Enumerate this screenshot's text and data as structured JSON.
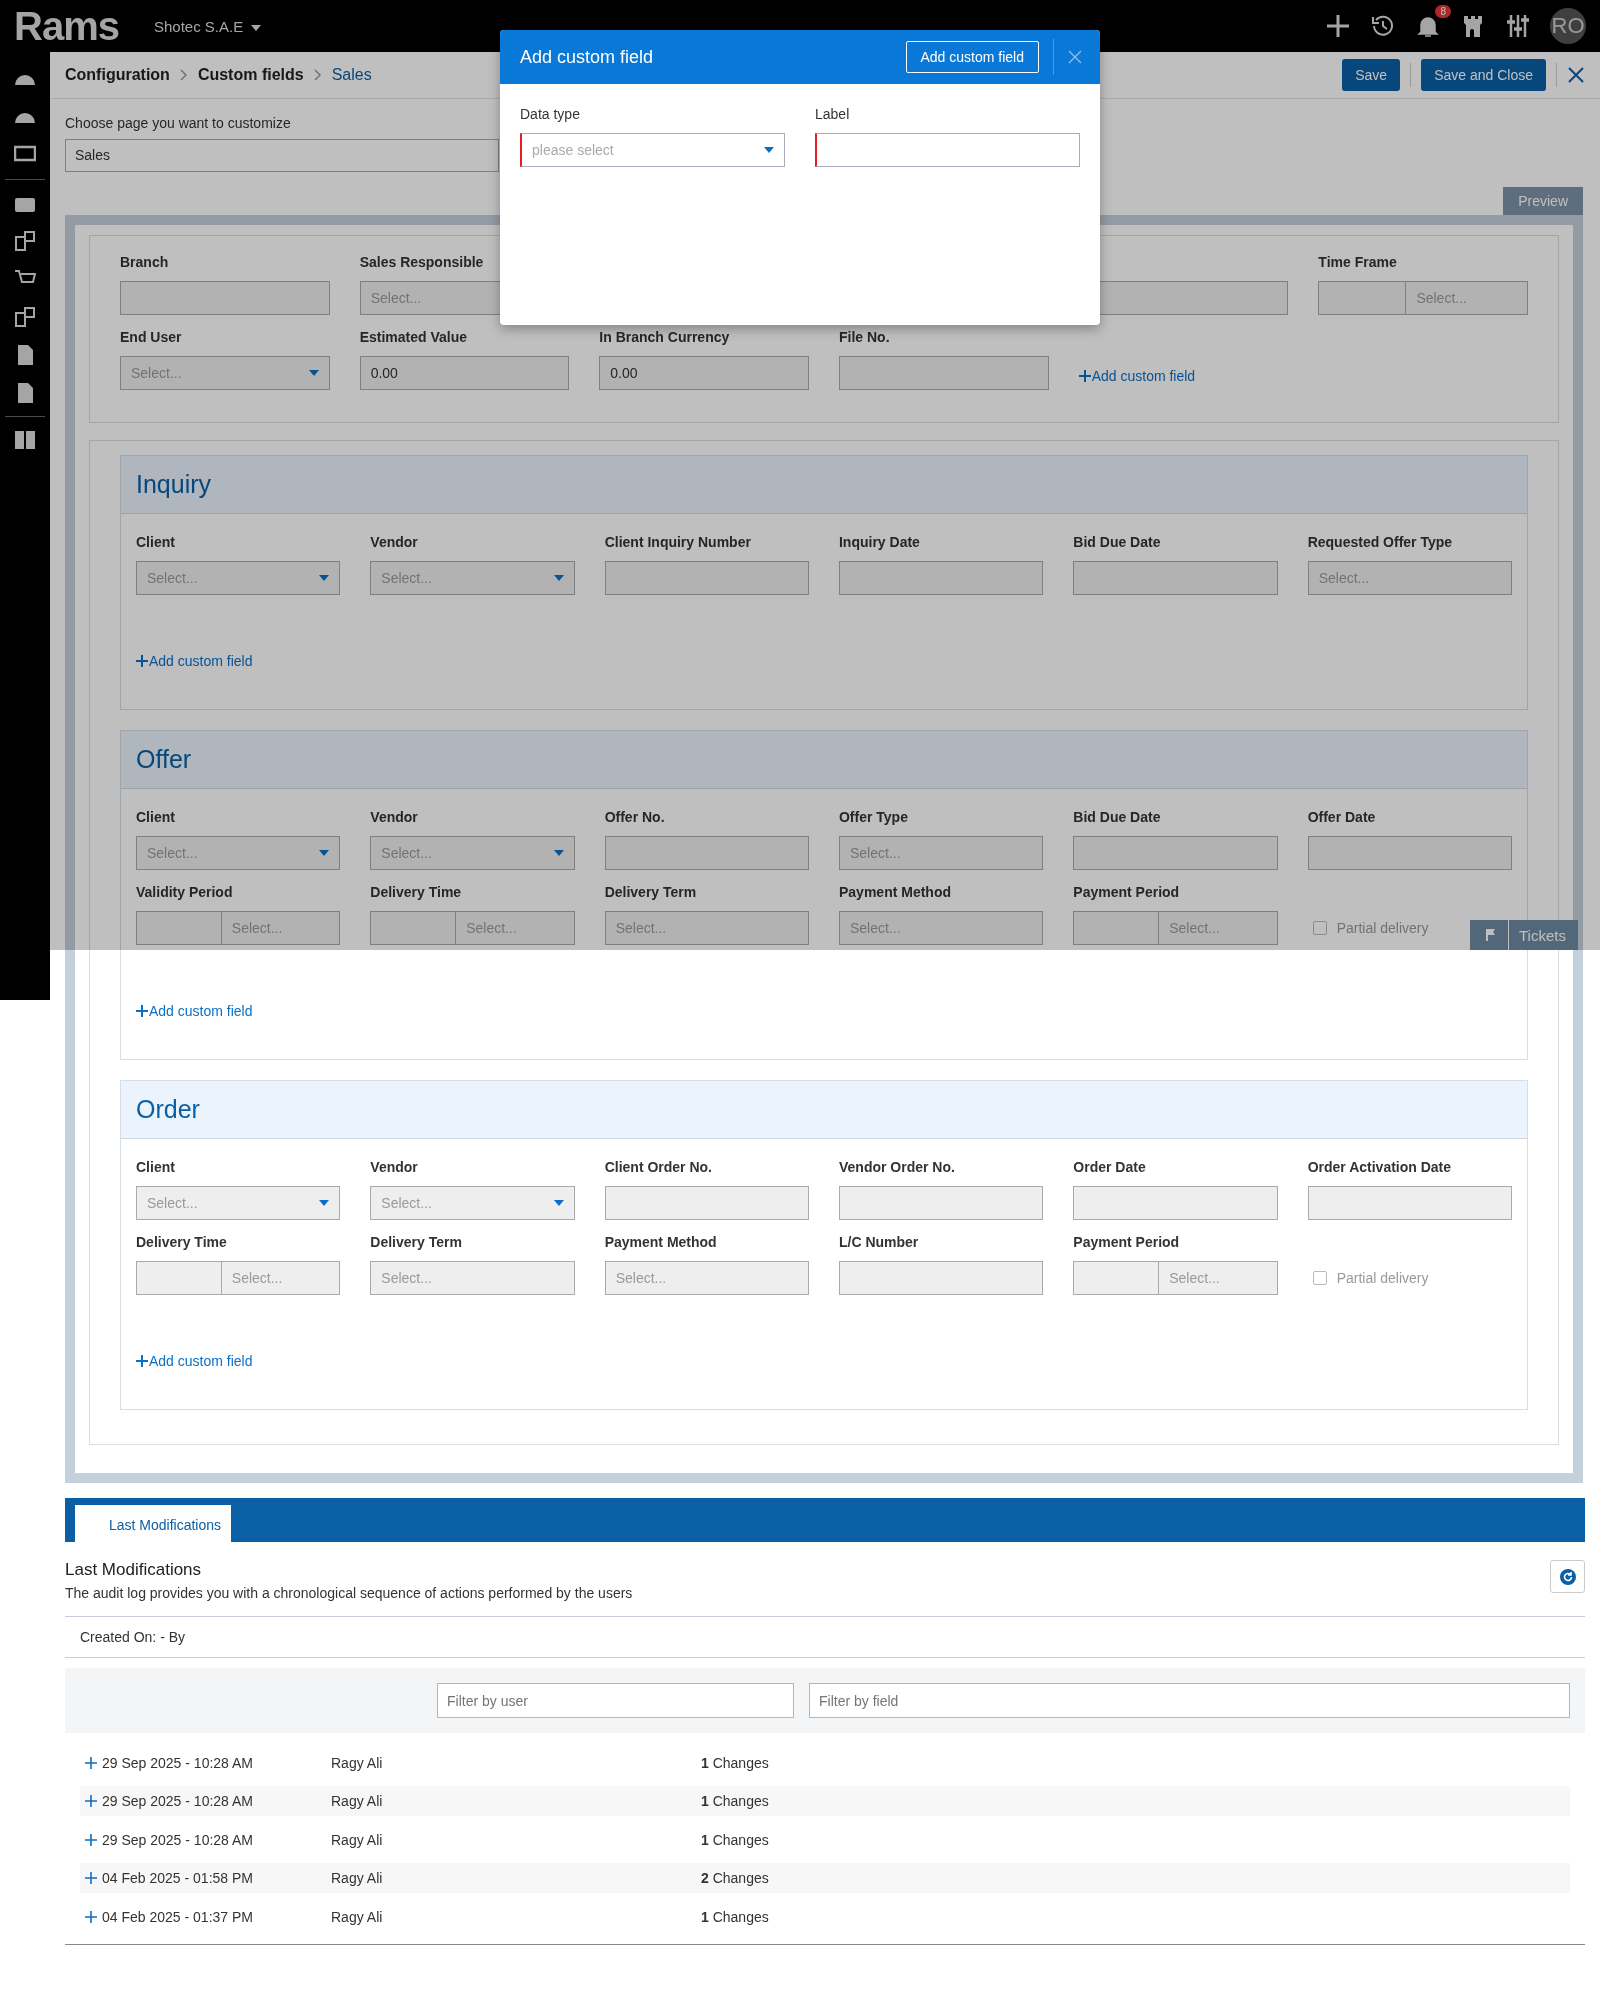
{
  "app": {
    "logo": "Rams",
    "company": "Shotec S.A.E",
    "notification_count": "8",
    "avatar": "RO"
  },
  "breadcrumb": [
    {
      "label": "Configuration",
      "current": false
    },
    {
      "label": "Custom fields",
      "current": false
    },
    {
      "label": "Sales",
      "current": true
    }
  ],
  "actions": [
    "Save",
    "Save and Close"
  ],
  "page_chooser": {
    "label": "Choose page you want to customize",
    "value": "Sales"
  },
  "preview_tab": "Preview",
  "general": {
    "fields": [
      {
        "label": "Branch",
        "kind": "input"
      },
      {
        "label": "Sales Responsible",
        "kind": "input",
        "placeholder": "Select..."
      },
      {
        "kind": "input"
      },
      {
        "label": "Time Frame",
        "kind": "split",
        "placeholder": "Select..."
      },
      {
        "label": "End User",
        "kind": "dropdown",
        "placeholder": "Select..."
      },
      {
        "label": "Estimated Value",
        "kind": "input",
        "value": "0.00"
      },
      {
        "label": "In Branch Currency",
        "kind": "input",
        "value": "0.00"
      },
      {
        "label": "File No.",
        "kind": "input"
      }
    ],
    "add_link": "Add custom field"
  },
  "sections": [
    {
      "title": "Inquiry",
      "fields": [
        {
          "label": "Client",
          "kind": "dropdown",
          "placeholder": "Select..."
        },
        {
          "label": "Vendor",
          "kind": "dropdown",
          "placeholder": "Select..."
        },
        {
          "label": "Client Inquiry Number",
          "kind": "input"
        },
        {
          "label": "Inquiry Date",
          "kind": "input"
        },
        {
          "label": "Bid Due Date",
          "kind": "input"
        },
        {
          "label": "Requested Offer Type",
          "kind": "input",
          "placeholder": "Select..."
        }
      ],
      "add_link": "Add custom field"
    },
    {
      "title": "Offer",
      "fields": [
        {
          "label": "Client",
          "kind": "dropdown",
          "placeholder": "Select..."
        },
        {
          "label": "Vendor",
          "kind": "dropdown",
          "placeholder": "Select..."
        },
        {
          "label": "Offer No.",
          "kind": "input"
        },
        {
          "label": "Offer Type",
          "kind": "input",
          "placeholder": "Select..."
        },
        {
          "label": "Bid Due Date",
          "kind": "input"
        },
        {
          "label": "Offer Date",
          "kind": "input"
        },
        {
          "label": "Validity Period",
          "kind": "split",
          "placeholder": "Select..."
        },
        {
          "label": "Delivery Time",
          "kind": "split",
          "placeholder": "Select..."
        },
        {
          "label": "Delivery Term",
          "kind": "input",
          "placeholder": "Select..."
        },
        {
          "label": "Payment Method",
          "kind": "input",
          "placeholder": "Select..."
        },
        {
          "label": "Payment Period",
          "kind": "split",
          "placeholder": "Select..."
        },
        {
          "label": "Partial delivery",
          "kind": "checkbox",
          "checked": false
        }
      ],
      "add_link": "Add custom field"
    },
    {
      "title": "Order",
      "fields": [
        {
          "label": "Client",
          "kind": "dropdown",
          "placeholder": "Select..."
        },
        {
          "label": "Vendor",
          "kind": "dropdown",
          "placeholder": "Select..."
        },
        {
          "label": "Client Order No.",
          "kind": "input"
        },
        {
          "label": "Vendor Order No.",
          "kind": "input"
        },
        {
          "label": "Order Date",
          "kind": "input"
        },
        {
          "label": "Order Activation Date",
          "kind": "input"
        },
        {
          "label": "Delivery Time",
          "kind": "split",
          "placeholder": "Select..."
        },
        {
          "label": "Delivery Term",
          "kind": "input",
          "placeholder": "Select..."
        },
        {
          "label": "Payment Method",
          "kind": "input",
          "placeholder": "Select..."
        },
        {
          "label": "L/C Number",
          "kind": "input"
        },
        {
          "label": "Payment Period",
          "kind": "split",
          "placeholder": "Select..."
        },
        {
          "label": "Partial delivery",
          "kind": "checkbox",
          "checked": false
        }
      ],
      "add_link": "Add custom field"
    }
  ],
  "tickets": "Tickets",
  "modal": {
    "title": "Add custom field",
    "button": "Add custom field",
    "fields": [
      {
        "label": "Data type",
        "kind": "dropdown",
        "placeholder": "please select"
      },
      {
        "label": "Label",
        "kind": "input"
      }
    ]
  },
  "audit": {
    "tab": "Last Modifications",
    "title": "Last Modifications",
    "description": "The audit log provides you with a chronological sequence of actions performed by the users",
    "created": "Created On: - By",
    "filters": [
      {
        "placeholder": "Filter by user"
      },
      {
        "placeholder": "Filter by field"
      }
    ],
    "rows": [
      {
        "date": "29 Sep 2025 - 10:28 AM",
        "user": "Ragy Ali",
        "count": "1",
        "changes": "Changes"
      },
      {
        "date": "29 Sep 2025 - 10:28 AM",
        "user": "Ragy Ali",
        "count": "1",
        "changes": "Changes"
      },
      {
        "date": "29 Sep 2025 - 10:28 AM",
        "user": "Ragy Ali",
        "count": "1",
        "changes": "Changes"
      },
      {
        "date": "04 Feb 2025 - 01:58 PM",
        "user": "Ragy Ali",
        "count": "2",
        "changes": "Changes"
      },
      {
        "date": "04 Feb 2025 - 01:37 PM",
        "user": "Ragy Ali",
        "count": "1",
        "changes": "Changes"
      }
    ]
  }
}
